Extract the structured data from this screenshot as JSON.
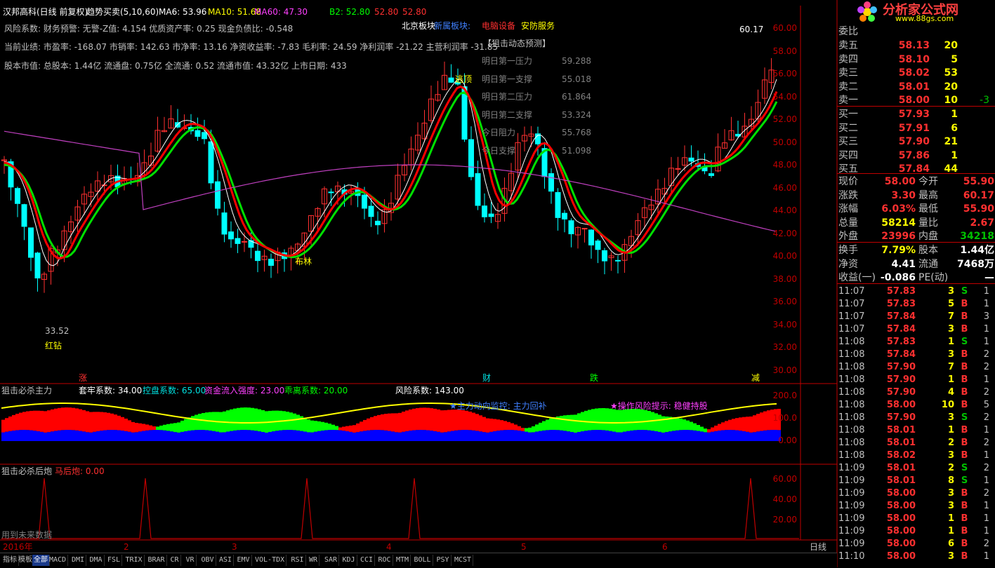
{
  "header": {
    "stock_name": "汉邦高科(日线 前复权)",
    "indicator_name": "趋势买卖(5,10,60)",
    "ma6_label": "MA6: 53.96",
    "ma10_label": "MA10: 51.68",
    "ma60_label": "MA60: 47.30",
    "b2_label": "B2: 52.80",
    "v2_label": "52.80",
    "v3_label": "52.80"
  },
  "info_lines": {
    "line1": "风险系数: 财务预警: 无警-Z值: 4.154 优质资产率: 0.25 现金负债比: -0.548",
    "line2": "当前业绩: 市盈率: -168.07 市销率: 142.63 市净率: 13.16 净资收益率: -7.83 毛利率: 24.59 净利润率 -21.22 主营利润率 -31.85",
    "line3": "股本市值: 总股本: 1.44亿 流通盘: 0.75亿 全流通: 0.52 流通市值: 43.32亿 上市日期: 433"
  },
  "sector": {
    "beijing": "北京板块",
    "new_sector": "新属板块:",
    "computer": "电脑设备",
    "security": "安防服务"
  },
  "forecast": {
    "title": "【狙击动态预测】",
    "rows": [
      {
        "label": "明日第一压力",
        "value": "59.288"
      },
      {
        "label": "明日第一支撑",
        "value": "55.018"
      },
      {
        "label": "明日第二压力",
        "value": "61.864"
      },
      {
        "label": "明日第二支撑",
        "value": "53.324"
      },
      {
        "label": "今日阻力",
        "value": "55.768"
      },
      {
        "label": "今日支撑",
        "value": "51.098"
      }
    ]
  },
  "annotations": {
    "top_price": "60.17",
    "low_price": "33.52",
    "escape": "逃顶",
    "bulin": "布林",
    "red_diamond": "红钻",
    "zhang": "涨",
    "cai": "财",
    "die": "跌",
    "jian": "减"
  },
  "y_axis_main": [
    "60.00",
    "58.00",
    "56.00",
    "54.00",
    "52.00",
    "50.00",
    "48.00",
    "46.00",
    "44.00",
    "42.00",
    "40.00",
    "38.00",
    "36.00",
    "34.00",
    "32.00",
    "30.00"
  ],
  "panel2": {
    "title": "狙击必杀主力",
    "tao": "套牢系数: 34.00",
    "kong": "控盘系数: 65.00",
    "zijin": "资金流入强度: 23.00",
    "guai": "乖离系数: 20.00",
    "risk": "风险系数: 143.00",
    "monitor": "★主力动向监控: 主力回补",
    "risk_tip": "★操作风险提示: 稳健持股",
    "y_axis": [
      "200.0",
      "100.0",
      "0.00"
    ]
  },
  "panel3": {
    "title": "狙击必杀后炮",
    "mahou": "马后炮: 0.00",
    "future": "用到未来数据",
    "y_axis": [
      "60.00",
      "40.00",
      "20.00"
    ]
  },
  "x_axis": {
    "labels": [
      "2016年",
      "2",
      "3",
      "4",
      "5",
      "6"
    ],
    "period": "日线"
  },
  "quote": {
    "weibi_label": "委比",
    "sell": [
      {
        "label": "卖五",
        "price": "58.13",
        "vol": "20",
        "delta": ""
      },
      {
        "label": "卖四",
        "price": "58.10",
        "vol": "5",
        "delta": ""
      },
      {
        "label": "卖三",
        "price": "58.02",
        "vol": "53",
        "delta": ""
      },
      {
        "label": "卖二",
        "price": "58.01",
        "vol": "20",
        "delta": ""
      },
      {
        "label": "卖一",
        "price": "58.00",
        "vol": "10",
        "delta": "-3"
      }
    ],
    "buy": [
      {
        "label": "买一",
        "price": "57.93",
        "vol": "1"
      },
      {
        "label": "买二",
        "price": "57.91",
        "vol": "6"
      },
      {
        "label": "买三",
        "price": "57.90",
        "vol": "21"
      },
      {
        "label": "买四",
        "price": "57.86",
        "vol": "1"
      },
      {
        "label": "买五",
        "price": "57.84",
        "vol": "44"
      }
    ],
    "stats": [
      {
        "l1": "现价",
        "v1": "58.00",
        "l2": "今开",
        "v2": "55.90"
      },
      {
        "l1": "涨跌",
        "v1": "3.30",
        "l2": "最高",
        "v2": "60.17"
      },
      {
        "l1": "涨幅",
        "v1": "6.03%",
        "l2": "最低",
        "v2": "55.90"
      },
      {
        "l1": "总量",
        "v1": "58214",
        "l2": "量比",
        "v2": "2.67"
      },
      {
        "l1": "外盘",
        "v1": "23996",
        "l2": "内盘",
        "v2": "34218"
      }
    ],
    "stats2": [
      {
        "l1": "换手",
        "v1": "7.79%",
        "l2": "股本",
        "v2": "1.44亿"
      },
      {
        "l1": "净资",
        "v1": "4.41",
        "l2": "流通",
        "v2": "7468万"
      },
      {
        "l1": "收益(一)",
        "v1": "-0.086",
        "l2": "PE(动)",
        "v2": "—"
      }
    ],
    "ticks": [
      {
        "t": "11:07",
        "p": "57.83",
        "v": "3",
        "bs": "S",
        "n": "1"
      },
      {
        "t": "11:07",
        "p": "57.83",
        "v": "5",
        "bs": "B",
        "n": "1"
      },
      {
        "t": "11:07",
        "p": "57.84",
        "v": "7",
        "bs": "B",
        "n": "3"
      },
      {
        "t": "11:07",
        "p": "57.84",
        "v": "3",
        "bs": "B",
        "n": "1"
      },
      {
        "t": "11:08",
        "p": "57.83",
        "v": "1",
        "bs": "S",
        "n": "1"
      },
      {
        "t": "11:08",
        "p": "57.84",
        "v": "3",
        "bs": "B",
        "n": "2"
      },
      {
        "t": "11:08",
        "p": "57.90",
        "v": "7",
        "bs": "B",
        "n": "2"
      },
      {
        "t": "11:08",
        "p": "57.90",
        "v": "1",
        "bs": "B",
        "n": "1"
      },
      {
        "t": "11:08",
        "p": "57.90",
        "v": "4",
        "bs": "B",
        "n": "2"
      },
      {
        "t": "11:08",
        "p": "58.00",
        "v": "10",
        "bs": "B",
        "n": "5"
      },
      {
        "t": "11:08",
        "p": "57.90",
        "v": "3",
        "bs": "S",
        "n": "2"
      },
      {
        "t": "11:08",
        "p": "58.01",
        "v": "1",
        "bs": "B",
        "n": "1"
      },
      {
        "t": "11:08",
        "p": "58.01",
        "v": "2",
        "bs": "B",
        "n": "2"
      },
      {
        "t": "11:08",
        "p": "58.02",
        "v": "3",
        "bs": "B",
        "n": "1"
      },
      {
        "t": "11:09",
        "p": "58.01",
        "v": "2",
        "bs": "S",
        "n": "2"
      },
      {
        "t": "11:09",
        "p": "58.01",
        "v": "8",
        "bs": "S",
        "n": "1"
      },
      {
        "t": "11:09",
        "p": "58.00",
        "v": "3",
        "bs": "B",
        "n": "2"
      },
      {
        "t": "11:09",
        "p": "58.00",
        "v": "3",
        "bs": "B",
        "n": "1"
      },
      {
        "t": "11:09",
        "p": "58.00",
        "v": "1",
        "bs": "B",
        "n": "1"
      },
      {
        "t": "11:09",
        "p": "58.00",
        "v": "1",
        "bs": "B",
        "n": "1"
      },
      {
        "t": "11:09",
        "p": "58.00",
        "v": "6",
        "bs": "B",
        "n": "2"
      },
      {
        "t": "11:10",
        "p": "58.00",
        "v": "3",
        "bs": "B",
        "n": "1"
      }
    ]
  },
  "tabs": [
    "指标",
    "模板",
    "全部",
    "MACD",
    "DMI",
    "DMA",
    "FSL",
    "TRIX",
    "BRAR",
    "CR",
    "VR",
    "OBV",
    "ASI",
    "EMV",
    "VOL-TDX",
    "RSI",
    "WR",
    "SAR",
    "KDJ",
    "CCI",
    "ROC",
    "MTM",
    "BOLL",
    "PSY",
    "MCST"
  ],
  "logo_text": "分析家公式网",
  "logo_url": "www.88gs.com",
  "colors": {
    "up": "#ff3030",
    "down": "#00ffff",
    "ma_green": "#00e000",
    "ma_red": "#ff0000",
    "ma60": "#c040c0"
  }
}
